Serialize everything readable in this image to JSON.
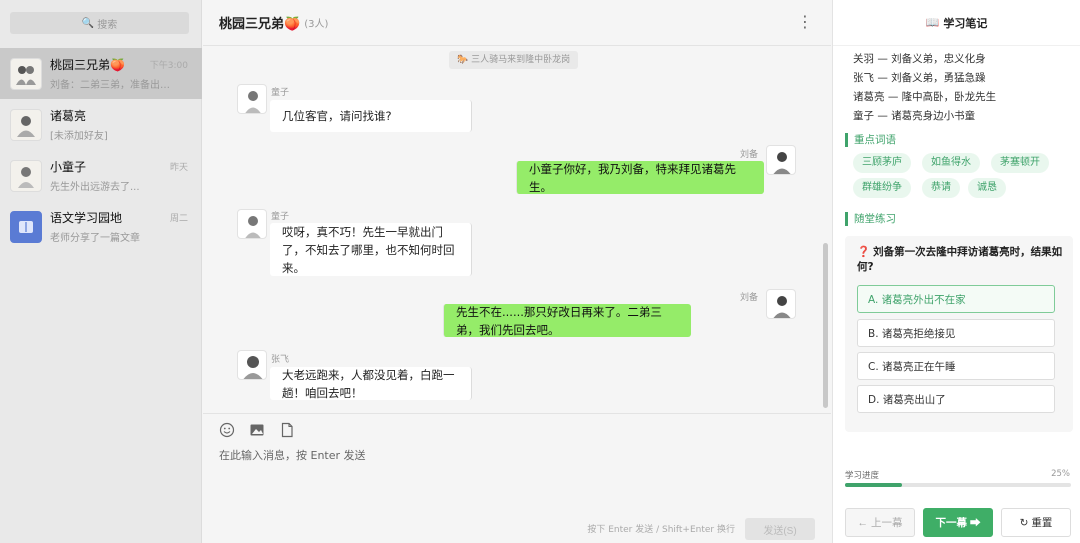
{
  "sidebar": {
    "search_placeholder": "搜索",
    "contacts": [
      {
        "name": "桃园三兄弟🍑",
        "preview": "刘备：二弟三弟，准备出发！",
        "time": "下午3:00",
        "active": true
      },
      {
        "name": "诸葛亮",
        "preview": "[未添加好友]",
        "time": ""
      },
      {
        "name": "小童子",
        "preview": "先生外出远游去了...",
        "time": "昨天"
      },
      {
        "name": "语文学习园地",
        "preview": "老师分享了一篇文章",
        "time": "周二"
      }
    ]
  },
  "chat": {
    "title": "桃园三兄弟🍑",
    "count": "(3人)",
    "system_message": "🐎 三人骑马来到隆中卧龙岗",
    "messages": [
      {
        "sender": "童子",
        "side": "left",
        "text": "几位客官，请问找谁?"
      },
      {
        "sender": "刘备",
        "side": "right",
        "text": "小童子你好，我乃刘备，特来拜见诸葛先生。"
      },
      {
        "sender": "童子",
        "side": "left",
        "text_line1": "哎呀，真不巧！先生一早就出门了，不知去了哪里，也不知何时回",
        "text_line2": "来。"
      },
      {
        "sender": "刘备",
        "side": "right",
        "text": "先生不在......那只好改日再来了。二弟三弟，我们先回去吧。"
      },
      {
        "sender": "张飞",
        "side": "left",
        "text": "大老远跑来，人都没见着，白跑一趟！咱回去吧！"
      }
    ],
    "composer_placeholder": "在此输入消息，按 Enter 发送",
    "hint": "按下 Enter 发送 / Shift+Enter 换行",
    "send_label": "发送(S)"
  },
  "notes": {
    "title": "学习笔记",
    "characters": [
      "关羽 — 刘备义弟，忠义化身",
      "张飞 — 刘备义弟，勇猛急躁",
      "诸葛亮 — 隆中高卧，卧龙先生",
      "童子 — 诸葛亮身边小书童"
    ],
    "vocab_heading": "重点词语",
    "vocab": [
      "三顾茅庐",
      "如鱼得水",
      "茅塞顿开",
      "群雄纷争",
      "恭请",
      "诚恳"
    ],
    "practice_heading": "随堂练习",
    "question": "刘备第一次去隆中拜访诸葛亮时，结果如何?",
    "options": [
      {
        "label": "A. 诸葛亮外出不在家",
        "selected": true
      },
      {
        "label": "B. 诸葛亮拒绝接见",
        "selected": false
      },
      {
        "label": "C. 诸葛亮正在午睡",
        "selected": false
      },
      {
        "label": "D. 诸葛亮出山了",
        "selected": false
      }
    ],
    "progress_label": "学习进度",
    "progress_pct": "25%",
    "progress_value": 0.25,
    "prev_label": "← 上一幕",
    "next_label": "下一幕 ➡",
    "reset_label": "↻ 重置"
  },
  "colors": {
    "accent_green": "#3fa36b",
    "bubble_green": "#95ec69"
  }
}
